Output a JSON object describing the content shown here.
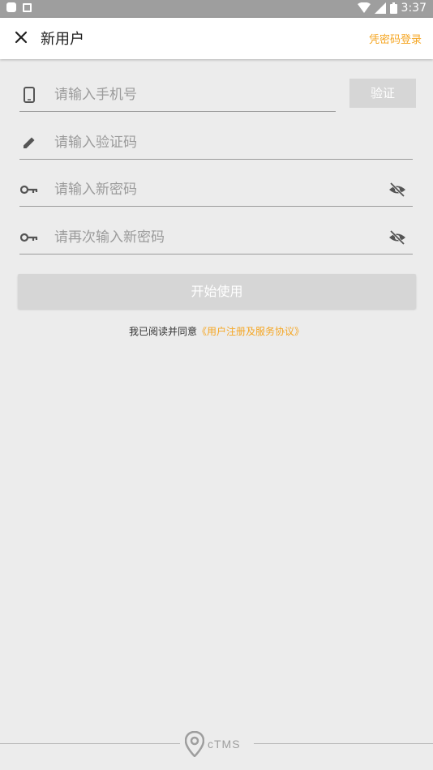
{
  "status_bar": {
    "time": "3:37"
  },
  "app_bar": {
    "title": "新用户",
    "password_login_label": "凭密码登录",
    "close_icon": "close-icon"
  },
  "form": {
    "phone": {
      "placeholder": "请输入手机号",
      "icon": "phone-icon"
    },
    "verify_button_label": "验证",
    "code": {
      "placeholder": "请输入验证码",
      "icon": "pencil-icon"
    },
    "new_password": {
      "placeholder": "请输入新密码",
      "icon": "key-icon"
    },
    "confirm_password": {
      "placeholder": "请再次输入新密码",
      "icon": "key-icon"
    },
    "start_button_label": "开始使用"
  },
  "agreement": {
    "prefix": "我已阅读并同意",
    "link": "《用户注册及服务协议》"
  },
  "footer": {
    "logo_text": "cTMS"
  },
  "colors": {
    "accent": "#f5a623",
    "disabled_button": "#d6d6d6",
    "background": "#ececec"
  }
}
